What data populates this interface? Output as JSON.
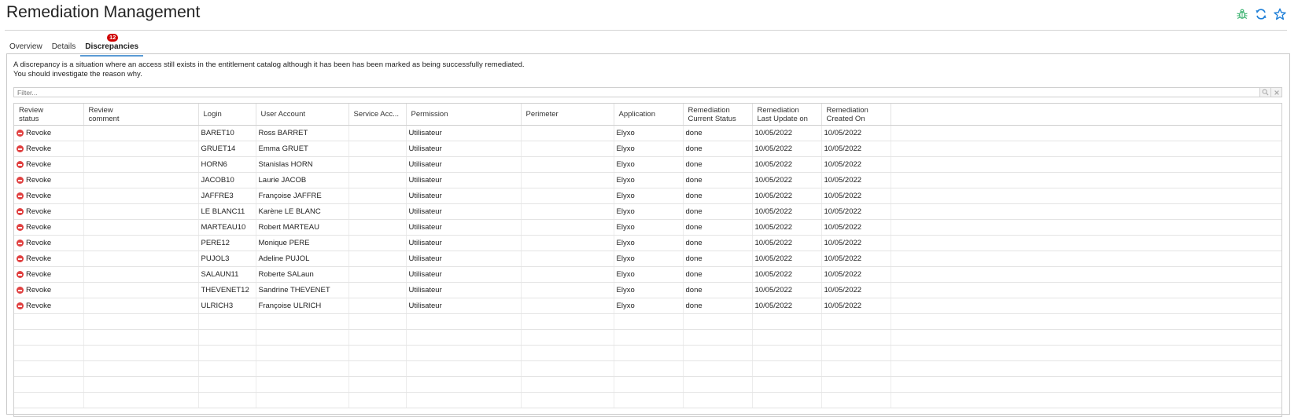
{
  "page": {
    "title": "Remediation Management",
    "icons": [
      "bug-icon",
      "refresh-icon",
      "star-icon"
    ]
  },
  "tabs": [
    {
      "label": "Overview",
      "active": false
    },
    {
      "label": "Details",
      "active": false
    },
    {
      "label": "Discrepancies",
      "active": true,
      "badge": "12"
    }
  ],
  "description": {
    "line1": "A discrepancy is a situation where an access still exists in the entitlement catalog although it has been has been marked as being successfully remediated.",
    "line2": "You should investigate the reason why."
  },
  "filter": {
    "placeholder": "Filter..."
  },
  "colors": {
    "accent": "#5b9bd5",
    "badge": "#d00000",
    "revoke": "#e04040",
    "icon_green": "#3cb371",
    "icon_blue": "#1e7fd8"
  },
  "table": {
    "columns": [
      {
        "line1": "Review",
        "line2": "status"
      },
      {
        "line1": "Review",
        "line2": "comment"
      },
      {
        "line1": "Login",
        "line2": ""
      },
      {
        "line1": "User Account",
        "line2": ""
      },
      {
        "line1": "Service Acc...",
        "line2": ""
      },
      {
        "line1": "Permission",
        "line2": ""
      },
      {
        "line1": "Perimeter",
        "line2": ""
      },
      {
        "line1": "Application",
        "line2": ""
      },
      {
        "line1": "Remediation",
        "line2": "Current Status"
      },
      {
        "line1": "Remediation",
        "line2": "Last Update on"
      },
      {
        "line1": "Remediation",
        "line2": "Created On"
      },
      {
        "line1": "",
        "line2": ""
      }
    ],
    "rows": [
      {
        "status": "Revoke",
        "comment": "",
        "login": "BARET10",
        "user": "Ross BARRET",
        "service": "",
        "permission": "Utilisateur",
        "perimeter": "",
        "application": "Elyxo",
        "current_status": "done",
        "last_update": "10/05/2022",
        "created": "10/05/2022"
      },
      {
        "status": "Revoke",
        "comment": "",
        "login": "GRUET14",
        "user": "Emma GRUET",
        "service": "",
        "permission": "Utilisateur",
        "perimeter": "",
        "application": "Elyxo",
        "current_status": "done",
        "last_update": "10/05/2022",
        "created": "10/05/2022"
      },
      {
        "status": "Revoke",
        "comment": "",
        "login": "HORN6",
        "user": "Stanislas HORN",
        "service": "",
        "permission": "Utilisateur",
        "perimeter": "",
        "application": "Elyxo",
        "current_status": "done",
        "last_update": "10/05/2022",
        "created": "10/05/2022"
      },
      {
        "status": "Revoke",
        "comment": "",
        "login": "JACOB10",
        "user": "Laurie JACOB",
        "service": "",
        "permission": "Utilisateur",
        "perimeter": "",
        "application": "Elyxo",
        "current_status": "done",
        "last_update": "10/05/2022",
        "created": "10/05/2022"
      },
      {
        "status": "Revoke",
        "comment": "",
        "login": "JAFFRE3",
        "user": "Françoise JAFFRE",
        "service": "",
        "permission": "Utilisateur",
        "perimeter": "",
        "application": "Elyxo",
        "current_status": "done",
        "last_update": "10/05/2022",
        "created": "10/05/2022"
      },
      {
        "status": "Revoke",
        "comment": "",
        "login": "LE BLANC11",
        "user": "Karène LE BLANC",
        "service": "",
        "permission": "Utilisateur",
        "perimeter": "",
        "application": "Elyxo",
        "current_status": "done",
        "last_update": "10/05/2022",
        "created": "10/05/2022"
      },
      {
        "status": "Revoke",
        "comment": "",
        "login": "MARTEAU10",
        "user": "Robert MARTEAU",
        "service": "",
        "permission": "Utilisateur",
        "perimeter": "",
        "application": "Elyxo",
        "current_status": "done",
        "last_update": "10/05/2022",
        "created": "10/05/2022"
      },
      {
        "status": "Revoke",
        "comment": "",
        "login": "PERE12",
        "user": "Monique PERE",
        "service": "",
        "permission": "Utilisateur",
        "perimeter": "",
        "application": "Elyxo",
        "current_status": "done",
        "last_update": "10/05/2022",
        "created": "10/05/2022"
      },
      {
        "status": "Revoke",
        "comment": "",
        "login": "PUJOL3",
        "user": "Adeline PUJOL",
        "service": "",
        "permission": "Utilisateur",
        "perimeter": "",
        "application": "Elyxo",
        "current_status": "done",
        "last_update": "10/05/2022",
        "created": "10/05/2022"
      },
      {
        "status": "Revoke",
        "comment": "",
        "login": "SALAUN11",
        "user": "Roberte SALaun",
        "service": "",
        "permission": "Utilisateur",
        "perimeter": "",
        "application": "Elyxo",
        "current_status": "done",
        "last_update": "10/05/2022",
        "created": "10/05/2022"
      },
      {
        "status": "Revoke",
        "comment": "",
        "login": "THEVENET12",
        "user": "Sandrine THEVENET",
        "service": "",
        "permission": "Utilisateur",
        "perimeter": "",
        "application": "Elyxo",
        "current_status": "done",
        "last_update": "10/05/2022",
        "created": "10/05/2022"
      },
      {
        "status": "Revoke",
        "comment": "",
        "login": "ULRICH3",
        "user": "Françoise ULRICH",
        "service": "",
        "permission": "Utilisateur",
        "perimeter": "",
        "application": "Elyxo",
        "current_status": "done",
        "last_update": "10/05/2022",
        "created": "10/05/2022"
      }
    ]
  }
}
